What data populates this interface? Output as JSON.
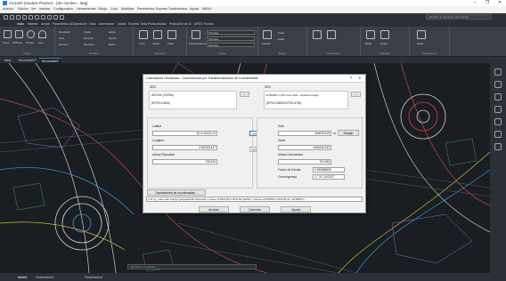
{
  "window": {
    "title": "Arc1540 (Student Product) - [Sin nombre - dwg]",
    "controls": [
      "–",
      "❐",
      "✕"
    ]
  },
  "menubar": [
    "Archivo",
    "Edición",
    "Ver",
    "Insertar",
    "Configuración",
    "Herramientas",
    "Dibujo",
    "Cota",
    "Modificar",
    "Paramétrico",
    "Express Tools",
    "Ventana",
    "Ayuda",
    "MENU"
  ],
  "search": {
    "placeholder": "Escriba un comando para buscar"
  },
  "ribbon_tabs": [
    "Inicio",
    "Insertar",
    "Anotar",
    "Paramétrico 3D",
    "Operación",
    "Vista",
    "Administrar",
    "Salida",
    "Express Tools",
    "Productividad",
    "Predicción de IA",
    "ARES",
    "Puntos"
  ],
  "ribbon_active_tab": "Inicio",
  "ribbon": {
    "groups": [
      "Dibujo",
      "Modificar",
      "Anotación",
      "Capas",
      "Bloque",
      "Propiedades",
      "Utilidades",
      "Portapapeles"
    ],
    "draw_labels": [
      "Línea",
      "Polilínea",
      "Círculo",
      "Arco"
    ],
    "modify_labels": [
      "Desplazar",
      "Girar",
      "Recortar",
      "Copiar",
      "Simetría",
      "Empalme",
      "Estirar",
      "Escala",
      "Matriz"
    ],
    "annotation_labels": [
      "Texto",
      "Acotar",
      "Tabla"
    ],
    "layer_labels": [
      "Propiedades de capa",
      "PorCapa",
      "PorCapa",
      "PorCapa"
    ],
    "block_labels": [
      "Insertar",
      "Crear",
      "Editar"
    ],
    "util_labels": [
      "Medir",
      "Grupo",
      "Pegar"
    ]
  },
  "doc_tabs": [
    "Inicio",
    "Sin nombre1*",
    "Sin nombre2*"
  ],
  "doc_active_tab": "Sin nombre2*",
  "status_bar": {
    "layout_tabs": [
      "Modelo",
      "Presentación1",
      "Presentación2"
    ],
    "command_placeholder": "Escriba un comando"
  },
  "dialog": {
    "title": "Calculadora Geodésica - Conversiones y/o Transformaciones de Coordenadas",
    "help_symbol": "?",
    "close_symbol": "✕",
    "source": {
      "label": "SRC",
      "crs_name": "WGS 84 (G2296)",
      "crs_code": "(EPSG:10605)",
      "browse_label": "..."
    },
    "target": {
      "label": "SRC",
      "crs_name": "ETRS89 / UTM zone 30N + Alicante height",
      "crs_code": "(EPSG:25830+EPSG:5782)",
      "browse_label": "..."
    },
    "source_coords": {
      "lat_label": "Latitud",
      "lat_value": "46.3+40421:23",
      "lon_label": "Longitud",
      "lon_value": "-3.820021447",
      "height_label": "Altitud Elipsoidal",
      "height_value": "705.876"
    },
    "target_coords": {
      "x_label": "Este",
      "x_value": "405678.415",
      "x_unit": "m",
      "draw_label": "Dibujar",
      "y_label": "Norte",
      "y_value": "4466346.343",
      "h_label": "Altitud Ortométrica",
      "h_value": "702.985",
      "scale_label": "Factor de Escala",
      "scale_value": "0.999656838",
      "conv_label": "Convergencia",
      "conv_value": "-1° 21' 10.0257\""
    },
    "forward_arrow": "⟶",
    "back_arrow": "⟵",
    "ops_button": "Operaciones de coordenadas...",
    "pipeline": "1.20 (m_) axis order change (geographic2D horizontal) + Inverse of WGS 84 to WGS 84 (G2296) + Inverse of ETRS89 to WGS 84 (2) + ETRS89 to ...",
    "accept_button": "Aceptar",
    "cancel_button": "Cancelar",
    "help_button": "Ayuda"
  }
}
